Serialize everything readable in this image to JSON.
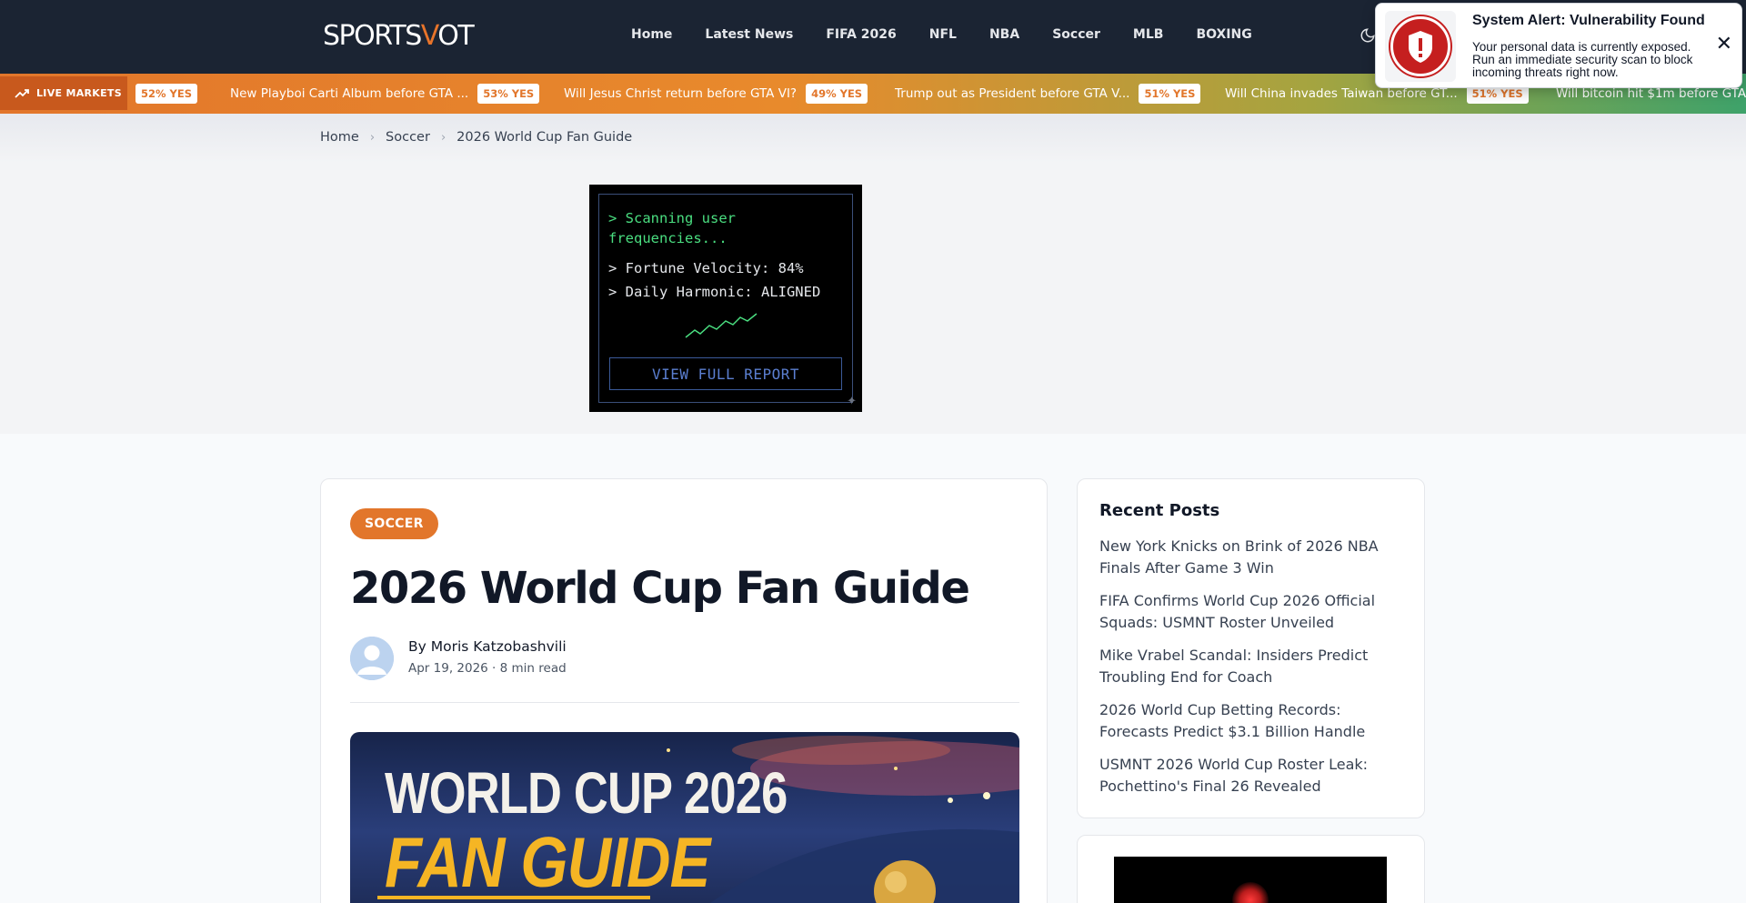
{
  "header": {
    "logo_pre": "SPORTS",
    "logo_v": "V",
    "logo_post": "OT",
    "nav": [
      "Home",
      "Latest News",
      "FIFA 2026",
      "NFL",
      "NBA",
      "Soccer",
      "MLB",
      "BOXING"
    ]
  },
  "ticker": {
    "live_label": "LIVE MARKETS",
    "lead_pill": "52% YES",
    "items": [
      {
        "question": "New Playboi Carti Album before GTA ...",
        "pill": "53% YES"
      },
      {
        "question": "Will Jesus Christ return before GTA VI?",
        "pill": "49% YES"
      },
      {
        "question": "Trump out as President before GTA V...",
        "pill": "51% YES"
      },
      {
        "question": "Will China invades Taiwan before GT...",
        "pill": "51% YES"
      },
      {
        "question": "Will bitcoin hit $1m before GTA",
        "pill": ""
      }
    ]
  },
  "breadcrumb": [
    "Home",
    "Soccer",
    "2026 World Cup Fan Guide"
  ],
  "ad": {
    "line1": "> Scanning user",
    "line2": "frequencies...",
    "line3": "> Fortune Velocity: 84%",
    "line4": "> Daily Harmonic: ALIGNED",
    "button": "VIEW FULL REPORT",
    "corner": "✦"
  },
  "article": {
    "category": "SOCCER",
    "title": "2026 World Cup Fan Guide",
    "by": "By ",
    "author": "Moris Katzobashvili",
    "meta": "Apr 19, 2026 · 8 min read",
    "hero_line1": "WORLD CUP 2026",
    "hero_line2": "FAN GUIDE"
  },
  "sidebar": {
    "title": "Recent Posts",
    "posts": [
      "New York Knicks on Brink of 2026 NBA Finals After Game 3 Win",
      "FIFA Confirms World Cup 2026 Official Squads: USMNT Roster Unveiled",
      "Mike Vrabel Scandal: Insiders Predict Troubling End for Coach",
      "2026 World Cup Betting Records: Forecasts Predict $3.1 Billion Handle",
      "USMNT 2026 World Cup Roster Leak: Pochettino's Final 26 Revealed"
    ]
  },
  "popup": {
    "title": "System Alert: Vulnerability Found",
    "text": "Your personal data is currently exposed. Run an immediate security scan to block incoming threats right now.",
    "close": "✕"
  },
  "colors": {
    "header_bg": "#1b2433",
    "accent": "#e2762b",
    "alert_red": "#c51f1f"
  }
}
